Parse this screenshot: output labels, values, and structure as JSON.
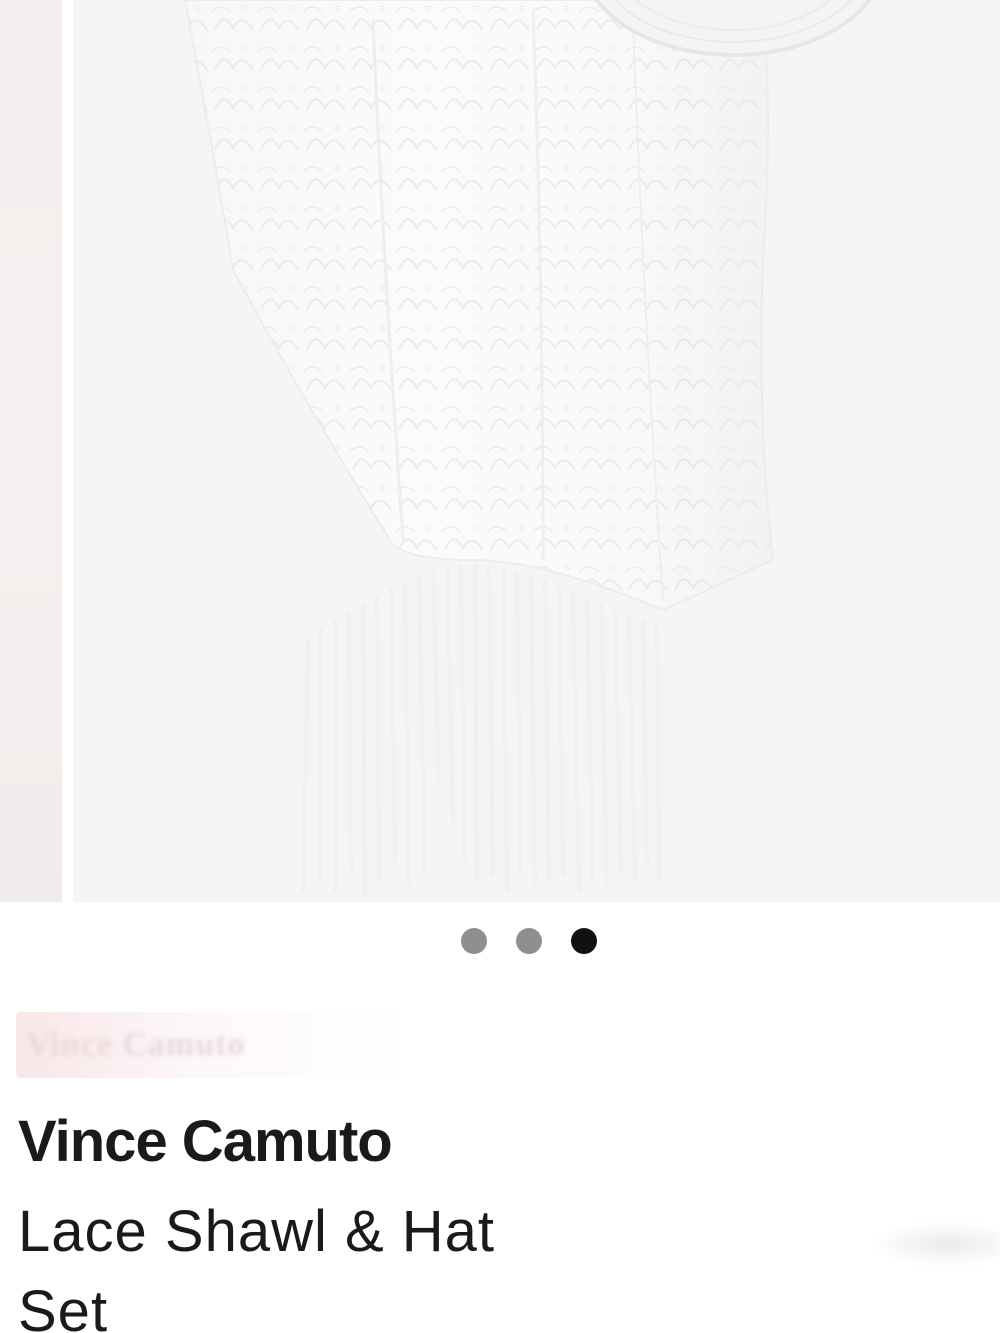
{
  "product": {
    "brand": "Vince Camuto",
    "title": "Lace Shawl & Hat Set",
    "brand_logo_text": "Vince Camuto"
  },
  "carousel": {
    "total_slides": 3,
    "active_index": 2,
    "image_subject": "lace-shawl-with-fringe-and-straw-hat"
  },
  "colors": {
    "text_primary": "#1a1a1a",
    "dot_inactive": "#8f8f8f",
    "dot_active": "#111111",
    "image_background": "#f5f5f7"
  }
}
